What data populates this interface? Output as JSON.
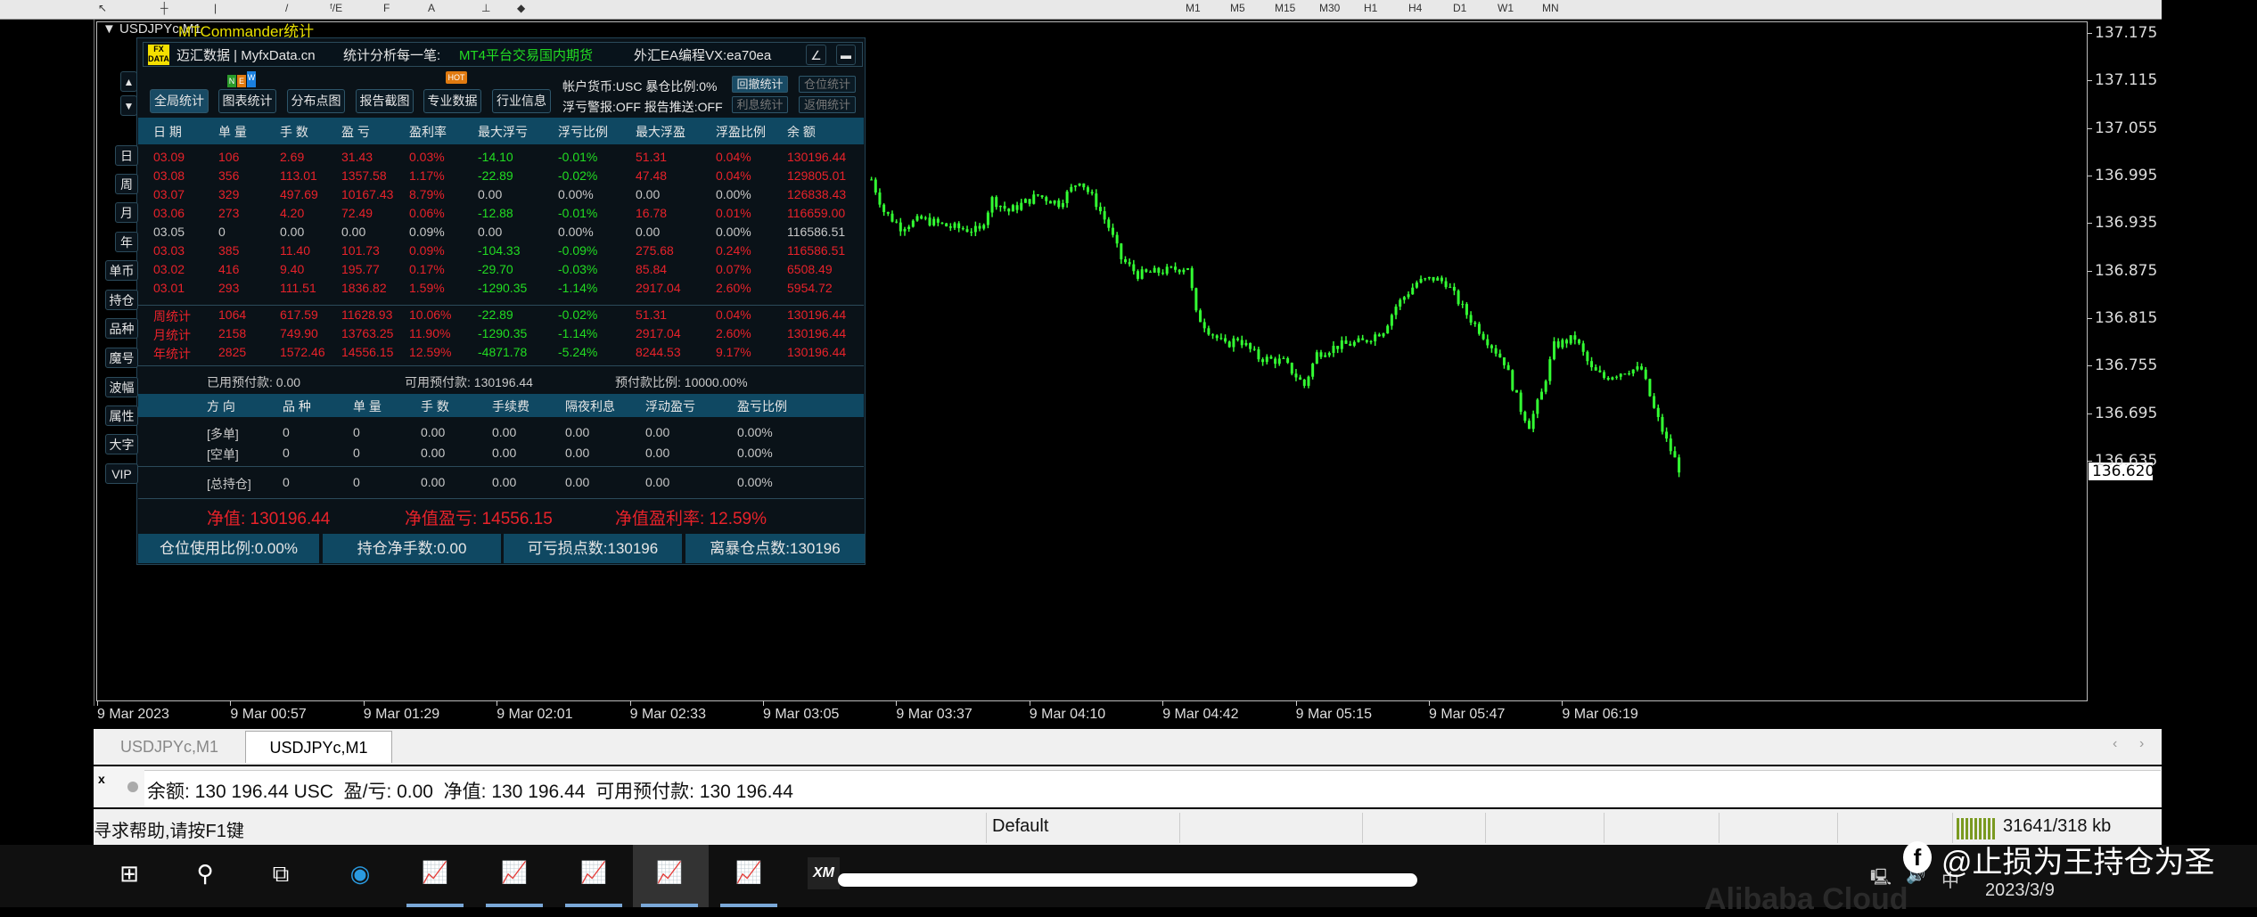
{
  "toolbar": {
    "icons": [
      "cursor",
      "crosshair",
      "vline",
      "hline",
      "trendline",
      "fibo",
      "text",
      "label",
      "arrow"
    ],
    "periods": [
      "M1",
      "M5",
      "M15",
      "M30",
      "H1",
      "H4",
      "D1",
      "W1",
      "MN"
    ]
  },
  "chart": {
    "header": "▼ USDJPYc,M1",
    "indicator_title": "MTCommander统计",
    "price_labels": [
      "137.175",
      "137.115",
      "137.055",
      "136.995",
      "136.935",
      "136.875",
      "136.815",
      "136.755",
      "136.695",
      "136.635"
    ],
    "current_price": "136.620",
    "time_labels": [
      "9 Mar 2023",
      "9 Mar 00:57",
      "9 Mar 01:29",
      "9 Mar 02:01",
      "9 Mar 02:33",
      "9 Mar 03:05",
      "9 Mar 03:37",
      "9 Mar 04:10",
      "9 Mar 04:42",
      "9 Mar 05:15",
      "9 Mar 05:47",
      "9 Mar 06:19"
    ],
    "candle_color": "#33ff33",
    "price_path": [
      [
        186,
        136.99
      ],
      [
        189,
        136.95
      ],
      [
        193,
        136.93
      ],
      [
        198,
        136.94
      ],
      [
        205,
        136.93
      ],
      [
        212,
        136.925
      ],
      [
        215,
        136.965
      ],
      [
        219,
        136.95
      ],
      [
        226,
        136.97
      ],
      [
        231,
        136.96
      ],
      [
        236,
        136.99
      ],
      [
        240,
        136.96
      ],
      [
        243,
        136.93
      ],
      [
        246,
        136.89
      ],
      [
        250,
        136.87
      ],
      [
        257,
        136.875
      ],
      [
        262,
        136.88
      ],
      [
        264,
        136.82
      ],
      [
        267,
        136.8
      ],
      [
        271,
        136.78
      ],
      [
        274,
        136.79
      ],
      [
        279,
        136.765
      ],
      [
        285,
        136.76
      ],
      [
        290,
        136.73
      ],
      [
        293,
        136.77
      ],
      [
        298,
        136.78
      ],
      [
        304,
        136.785
      ],
      [
        309,
        136.8
      ],
      [
        312,
        136.83
      ],
      [
        317,
        136.86
      ],
      [
        321,
        136.865
      ],
      [
        324,
        136.86
      ],
      [
        329,
        136.82
      ],
      [
        335,
        136.78
      ],
      [
        338,
        136.76
      ],
      [
        342,
        136.7
      ],
      [
        344,
        136.68
      ],
      [
        347,
        136.72
      ],
      [
        350,
        136.78
      ],
      [
        355,
        136.79
      ],
      [
        359,
        136.75
      ],
      [
        362,
        136.74
      ],
      [
        368,
        136.75
      ],
      [
        371,
        136.75
      ],
      [
        374,
        136.7
      ],
      [
        377,
        136.66
      ],
      [
        380,
        136.625
      ]
    ]
  },
  "side_buttons": {
    "up": "▲",
    "down": "▼",
    "items": [
      "日",
      "周",
      "月",
      "年",
      "单币",
      "持仓",
      "品种",
      "魔号",
      "波幅",
      "属性",
      "大字",
      "VIP"
    ]
  },
  "panel": {
    "logo": "FX DATA",
    "brand": "迈汇数据 | MyfxData.cn",
    "slogan": "统计分析每一笔:",
    "promo": "MT4平台交易国内期货",
    "contact": "外汇EA编程VX:ea70ea",
    "edit_icon": "∠",
    "minimize_icon": "▬",
    "tabs": [
      "全局统计",
      "图表统计",
      "分布点图",
      "报告截图",
      "专业数据",
      "行业信息"
    ],
    "badges": {
      "new": [
        "N",
        "E",
        "W"
      ],
      "hot": "HOT"
    },
    "info": {
      "line1": "帐户货币:USC 暴仓比例:0%",
      "line2": "浮亏警报:OFF 报告推送:OFF"
    },
    "mini_buttons": [
      "回撤统计",
      "仓位统计",
      "利息统计",
      "返佣统计"
    ],
    "columns": [
      "日 期",
      "单 量",
      "手 数",
      "盈 亏",
      "盈利率",
      "最大浮亏",
      "浮亏比例",
      "最大浮盈",
      "浮盈比例",
      "余 额"
    ],
    "rows": [
      {
        "tone": "red",
        "cells": [
          "03.09",
          "106",
          "2.69",
          "31.43",
          "0.03%",
          "-14.10",
          "-0.01%",
          "51.31",
          "0.04%",
          "130196.44"
        ]
      },
      {
        "tone": "red",
        "cells": [
          "03.08",
          "356",
          "113.01",
          "1357.58",
          "1.17%",
          "-22.89",
          "-0.02%",
          "47.48",
          "0.04%",
          "129805.01"
        ]
      },
      {
        "tone": "red",
        "cells": [
          "03.07",
          "329",
          "497.69",
          "10167.43",
          "8.79%",
          "0.00",
          "0.00%",
          "0.00",
          "0.00%",
          "126838.43"
        ]
      },
      {
        "tone": "red",
        "cells": [
          "03.06",
          "273",
          "4.20",
          "72.49",
          "0.06%",
          "-12.88",
          "-0.01%",
          "16.78",
          "0.01%",
          "116659.00"
        ]
      },
      {
        "tone": "gray",
        "cells": [
          "03.05",
          "0",
          "0.00",
          "0.00",
          "0.09%",
          "0.00",
          "0.00%",
          "0.00",
          "0.00%",
          "116586.51"
        ]
      },
      {
        "tone": "red",
        "cells": [
          "03.03",
          "385",
          "11.40",
          "101.73",
          "0.09%",
          "-104.33",
          "-0.09%",
          "275.68",
          "0.24%",
          "116586.51"
        ]
      },
      {
        "tone": "red",
        "cells": [
          "03.02",
          "416",
          "9.40",
          "195.77",
          "0.17%",
          "-29.70",
          "-0.03%",
          "85.84",
          "0.07%",
          "6508.49"
        ]
      },
      {
        "tone": "red",
        "cells": [
          "03.01",
          "293",
          "111.51",
          "1836.82",
          "1.59%",
          "-1290.35",
          "-1.14%",
          "2917.04",
          "2.60%",
          "5954.72"
        ]
      }
    ],
    "summary": [
      {
        "tone": "red",
        "cells": [
          "周统计",
          "1064",
          "617.59",
          "11628.93",
          "10.06%",
          "-22.89",
          "-0.02%",
          "51.31",
          "0.04%",
          "130196.44"
        ]
      },
      {
        "tone": "red",
        "cells": [
          "月统计",
          "2158",
          "749.90",
          "13763.25",
          "11.90%",
          "-1290.35",
          "-1.14%",
          "2917.04",
          "2.60%",
          "130196.44"
        ]
      },
      {
        "tone": "red",
        "cells": [
          "年统计",
          "2825",
          "1572.46",
          "14556.15",
          "12.59%",
          "-4871.78",
          "-5.24%",
          "8244.53",
          "9.17%",
          "130196.44"
        ]
      }
    ],
    "margin": {
      "used": "已用预付款: 0.00",
      "free": "可用预付款: 130196.44",
      "ratio": "预付款比例: 10000.00%"
    },
    "pos_columns": [
      "方 向",
      "品 种",
      "单 量",
      "手 数",
      "手续费",
      "隔夜利息",
      "浮动盈亏",
      "盈亏比例"
    ],
    "positions": [
      [
        "[多单]",
        "0",
        "0",
        "0.00",
        "0.00",
        "0.00",
        "0.00",
        "0.00%"
      ],
      [
        "[空单]",
        "0",
        "0",
        "0.00",
        "0.00",
        "0.00",
        "0.00",
        "0.00%"
      ],
      [
        "[总持仓]",
        "0",
        "0",
        "0.00",
        "0.00",
        "0.00",
        "0.00",
        "0.00%"
      ]
    ],
    "equity": {
      "equity": "净值: 130196.44",
      "pnl": "净值盈亏: 14556.15",
      "rate": "净值盈利率: 12.59%"
    },
    "footer": [
      "仓位使用比例:0.00%",
      "持仓净手数:0.00",
      "可亏损点数:130196",
      "离暴仓点数:130196"
    ]
  },
  "tabs": [
    "USDJPYc,M1",
    "USDJPYc,M1"
  ],
  "terminal": {
    "close": "x",
    "text": "余额: 130 196.44 USC  盈/亏: 0.00  净值: 130 196.44  可用预付款: 130 196.44"
  },
  "statusbar": {
    "help": "寻求帮助,请按F1键",
    "profile": "Default",
    "traffic": "31641/318 kb"
  },
  "taskbar": {
    "date": "2023/3/9",
    "ime": "中",
    "watermark": "@止损为王持仓为圣",
    "cloud": "Alibaba Cloud",
    "xm": "XM"
  }
}
